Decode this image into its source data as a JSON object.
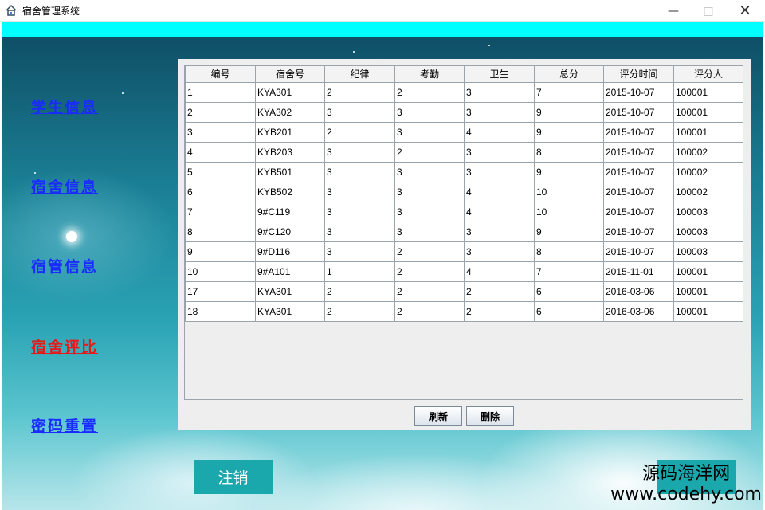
{
  "window": {
    "title": "宿舍管理系统",
    "minimize_glyph": "—",
    "maximize_glyph": "□",
    "close_glyph": "✕"
  },
  "sidebar": {
    "items": [
      {
        "label": "学生信息",
        "active": false
      },
      {
        "label": "宿舍信息",
        "active": false
      },
      {
        "label": "宿管信息",
        "active": false
      },
      {
        "label": "宿舍评比",
        "active": true
      },
      {
        "label": "密码重置",
        "active": false
      }
    ]
  },
  "table": {
    "columns": [
      "编号",
      "宿舍号",
      "纪律",
      "考勤",
      "卫生",
      "总分",
      "评分时间",
      "评分人"
    ],
    "rows": [
      [
        "1",
        "KYA301",
        "2",
        "2",
        "3",
        "7",
        "2015-10-07",
        "100001"
      ],
      [
        "2",
        "KYA302",
        "3",
        "3",
        "3",
        "9",
        "2015-10-07",
        "100001"
      ],
      [
        "3",
        "KYB201",
        "2",
        "3",
        "4",
        "9",
        "2015-10-07",
        "100001"
      ],
      [
        "4",
        "KYB203",
        "3",
        "2",
        "3",
        "8",
        "2015-10-07",
        "100002"
      ],
      [
        "5",
        "KYB501",
        "3",
        "3",
        "3",
        "9",
        "2015-10-07",
        "100002"
      ],
      [
        "6",
        "KYB502",
        "3",
        "3",
        "4",
        "10",
        "2015-10-07",
        "100002"
      ],
      [
        "7",
        "9#C119",
        "3",
        "3",
        "4",
        "10",
        "2015-10-07",
        "100003"
      ],
      [
        "8",
        "9#C120",
        "3",
        "3",
        "3",
        "9",
        "2015-10-07",
        "100003"
      ],
      [
        "9",
        "9#D116",
        "3",
        "2",
        "3",
        "8",
        "2015-10-07",
        "100003"
      ],
      [
        "10",
        "9#A101",
        "1",
        "2",
        "4",
        "7",
        "2015-11-01",
        "100001"
      ],
      [
        "17",
        "KYA301",
        "2",
        "2",
        "2",
        "6",
        "2016-03-06",
        "100001"
      ],
      [
        "18",
        "KYA301",
        "2",
        "2",
        "2",
        "6",
        "2016-03-06",
        "100001"
      ]
    ]
  },
  "actions": {
    "refresh_label": "刷新",
    "delete_label": "删除",
    "logout_label": "注销"
  },
  "watermark": {
    "name": "源码海洋网",
    "url": "www.codehy.com"
  },
  "colors": {
    "accent_cyan": "#00ffff",
    "nav_link": "#1a2bff",
    "nav_active": "#e01c1c",
    "logout_bg": "#1aa8ac"
  }
}
